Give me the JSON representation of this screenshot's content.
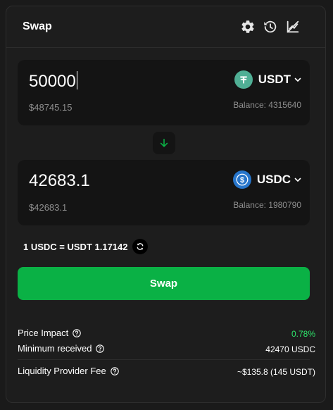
{
  "header": {
    "title": "Swap",
    "icons": [
      "settings-gear-icon",
      "history-icon",
      "chart-off-icon"
    ]
  },
  "from": {
    "amount": "50000",
    "usd_value": "$48745.15",
    "token": "USDT",
    "balance": "Balance: 4315640",
    "logo_color": "#50af95"
  },
  "to": {
    "amount": "42683.1",
    "usd_value": "$42683.1",
    "token": "USDC",
    "balance": "Balance: 1980790",
    "logo_color": "#2775ca"
  },
  "rate": {
    "text": "1 USDC = USDT 1.17142"
  },
  "swap_button": {
    "label": "Swap",
    "color": "#0ab145"
  },
  "details": {
    "price_impact_label": "Price Impact",
    "price_impact_value": "0.78%",
    "price_impact_color": "#2ee66b",
    "min_received_label": "Minimum received",
    "min_received_value": "42470 USDC",
    "lp_fee_label": "Liquidity Provider Fee",
    "lp_fee_value": "~$135.8 (145 USDT)"
  }
}
